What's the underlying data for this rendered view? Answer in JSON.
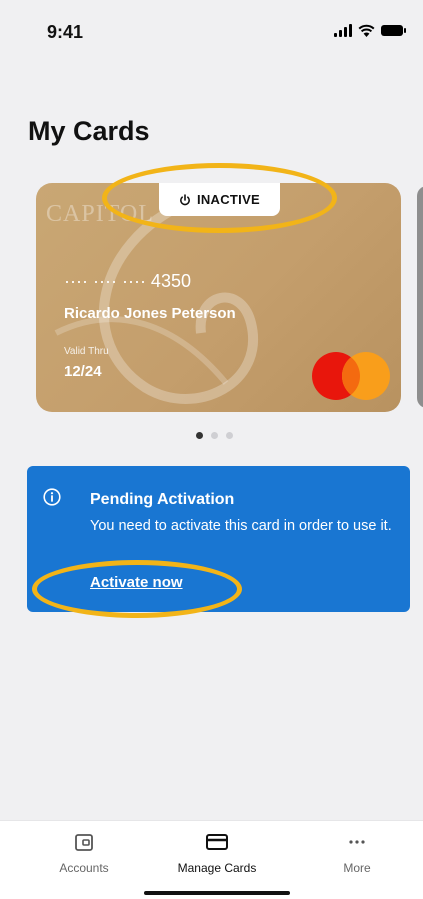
{
  "status_bar": {
    "time": "9:41",
    "icons": [
      "signal-icon",
      "wifi-icon",
      "battery-icon"
    ]
  },
  "page": {
    "title": "My Cards"
  },
  "card": {
    "brand": "CAPITOL",
    "status": "INACTIVE",
    "status_icon": "power-icon",
    "number": "···· ···· ···· 4350",
    "holder": "Ricardo Jones Peterson",
    "valid_label": "Valid Thru",
    "expiry": "12/24",
    "network": "mastercard-logo",
    "color": "#c6a170"
  },
  "pager": {
    "count": 3,
    "active_index": 0
  },
  "banner": {
    "icon": "info-icon",
    "title": "Pending Activation",
    "message": "You need to activate this card in order to use it.",
    "link": "Activate now",
    "background": "#1976d2"
  },
  "tab_bar": {
    "tabs": [
      {
        "label": "Accounts",
        "icon": "wallet-icon",
        "active": false
      },
      {
        "label": "Manage Cards",
        "icon": "card-icon",
        "active": true
      },
      {
        "label": "More",
        "icon": "more-icon",
        "active": false
      }
    ]
  },
  "colors": {
    "highlight": "#f2b418",
    "mastercard_red": "#e8160c",
    "mastercard_orange": "#f99e1b"
  }
}
